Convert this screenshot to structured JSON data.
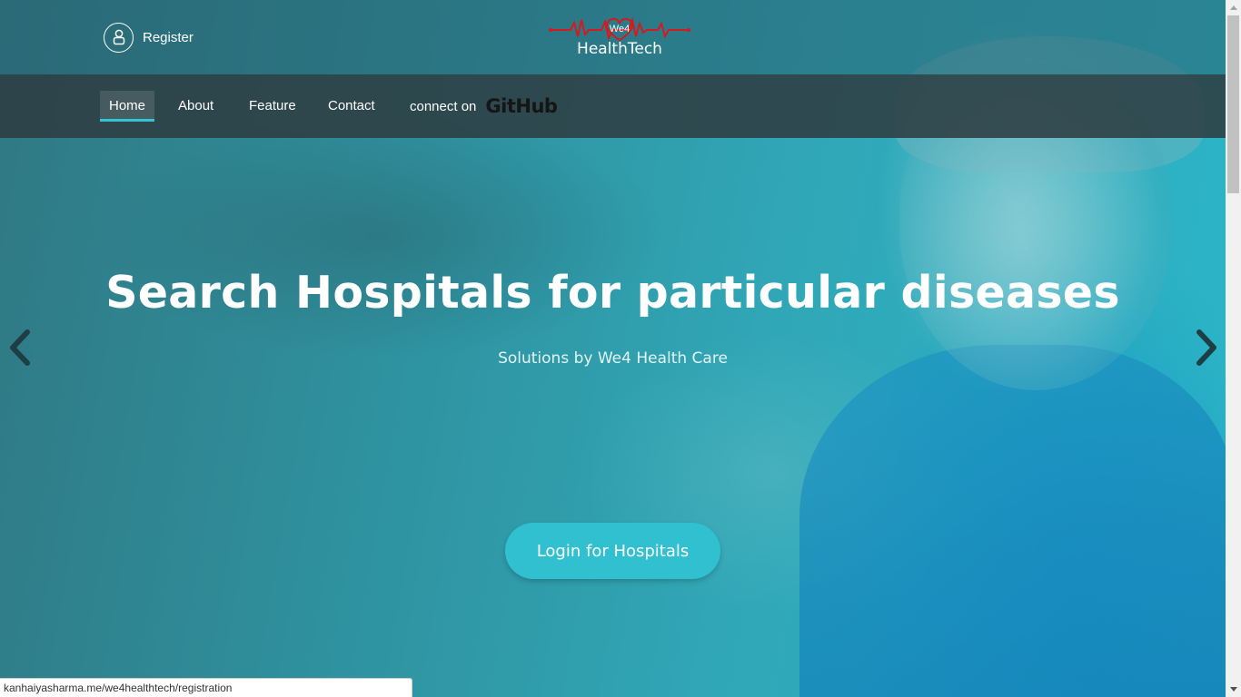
{
  "header": {
    "register_label": "Register",
    "logo": {
      "small_text": "We4",
      "brand_text": "HealthTech",
      "accent_color": "#d6191c"
    }
  },
  "nav": {
    "items": [
      {
        "label": "Home",
        "active": true
      },
      {
        "label": "About",
        "active": false
      },
      {
        "label": "Feature",
        "active": false
      },
      {
        "label": "Contact",
        "active": false
      }
    ],
    "github_prefix": "connect on",
    "github_word": "GitHub"
  },
  "hero": {
    "title": "Search Hospitals for particular diseases",
    "subtitle": "Solutions by We4 Health Care",
    "cta_label": "Login for Hospitals",
    "prev_icon": "chevron-left-icon",
    "next_icon": "chevron-right-icon"
  },
  "status_bar": {
    "url": "kanhaiyasharma.me/we4healthtech/registration"
  },
  "colors": {
    "accent": "#30c0d0",
    "nav_bg": "#2d3e42",
    "hero_tint": "#2fa3b3"
  }
}
